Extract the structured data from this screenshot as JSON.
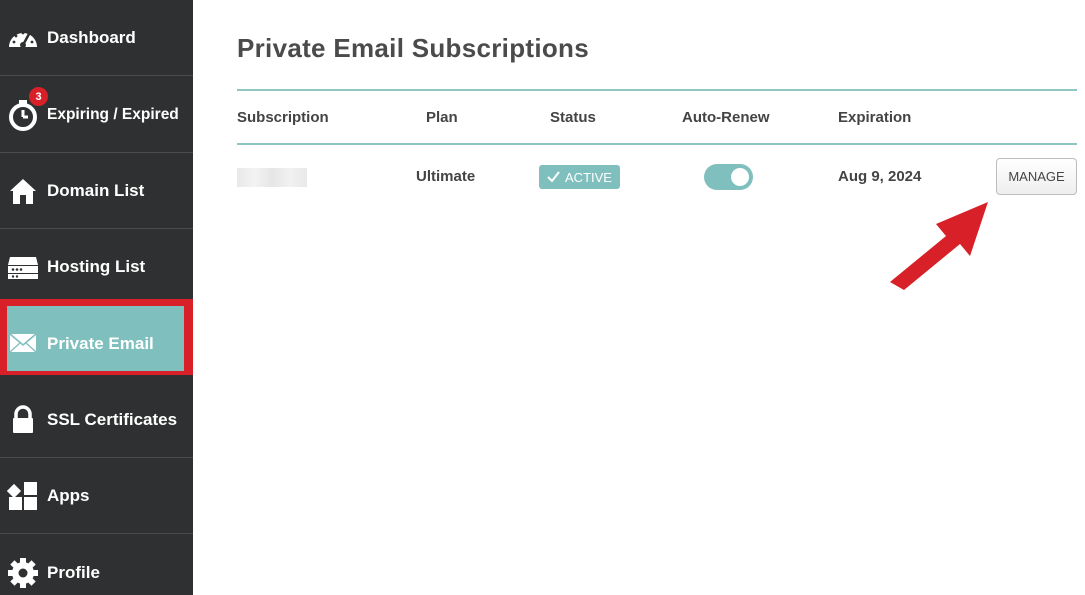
{
  "sidebar": {
    "items": [
      {
        "label": "Dashboard",
        "icon": "speedometer-icon"
      },
      {
        "label": "Expiring / Expired",
        "icon": "stopwatch-icon",
        "badge": "3"
      },
      {
        "label": "Domain List",
        "icon": "home-icon"
      },
      {
        "label": "Hosting List",
        "icon": "server-icon"
      },
      {
        "label": "Private Email",
        "icon": "envelope-icon",
        "active": true
      },
      {
        "label": "SSL Certificates",
        "icon": "lock-icon"
      },
      {
        "label": "Apps",
        "icon": "apps-icon"
      },
      {
        "label": "Profile",
        "icon": "gear-icon"
      }
    ]
  },
  "main": {
    "title": "Private Email Subscriptions",
    "columns": [
      "Subscription",
      "Plan",
      "Status",
      "Auto-Renew",
      "Expiration"
    ],
    "rows": [
      {
        "subscription": "",
        "plan": "Ultimate",
        "status": "ACTIVE",
        "auto_renew": true,
        "expiration": "Aug 9, 2024",
        "action": "MANAGE"
      }
    ]
  },
  "colors": {
    "sidebar_bg": "#2f3031",
    "accent_teal": "#7fbfbd",
    "highlight_red": "#d72027",
    "badge_red": "#d72027"
  }
}
